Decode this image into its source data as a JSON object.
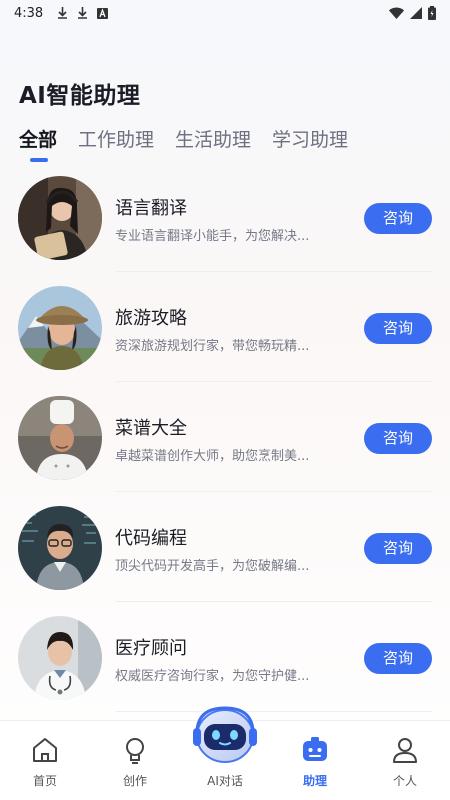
{
  "status": {
    "time": "4:38"
  },
  "page_title": "AI智能助理",
  "tabs": [
    {
      "label": "全部",
      "active": true
    },
    {
      "label": "工作助理",
      "active": false
    },
    {
      "label": "生活助理",
      "active": false
    },
    {
      "label": "学习助理",
      "active": false
    }
  ],
  "assistants": [
    {
      "name": "语言翻译",
      "desc": "专业语言翻译小能手，为您解决...",
      "button": "咨询"
    },
    {
      "name": "旅游攻略",
      "desc": "资深旅游规划行家，带您畅玩精...",
      "button": "咨询"
    },
    {
      "name": "菜谱大全",
      "desc": "卓越菜谱创作大师，助您烹制美...",
      "button": "咨询"
    },
    {
      "name": "代码编程",
      "desc": "顶尖代码开发高手，为您破解编...",
      "button": "咨询"
    },
    {
      "name": "医疗顾问",
      "desc": "权威医疗咨询行家，为您守护健...",
      "button": "咨询"
    }
  ],
  "nav": {
    "home": "首页",
    "create": "创作",
    "ai_chat": "AI对话",
    "assistant": "助理",
    "profile": "个人"
  },
  "colors": {
    "accent": "#3a6df0"
  }
}
